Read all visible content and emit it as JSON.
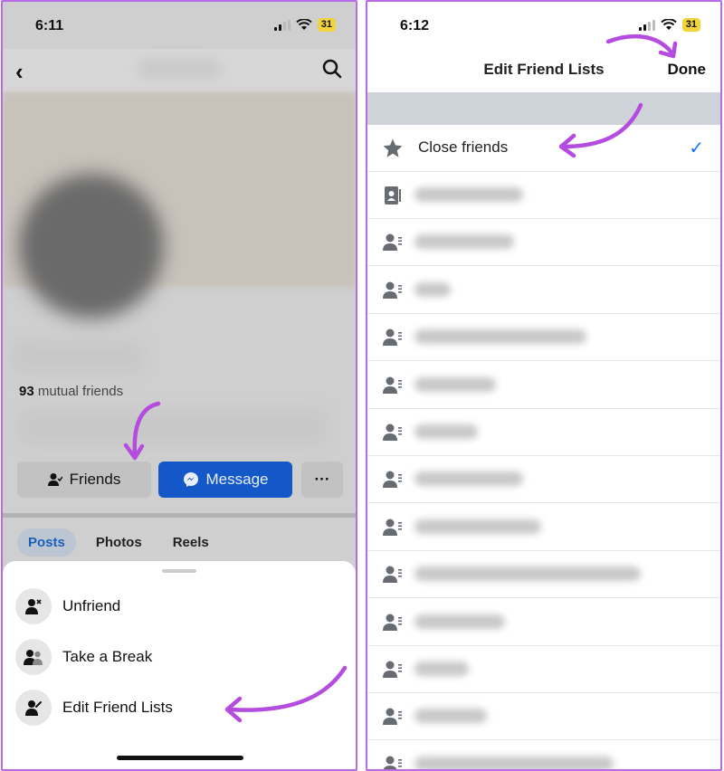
{
  "left_screen": {
    "status": {
      "time": "6:11",
      "battery": "31"
    },
    "mutual_count": "93",
    "mutual_text": "mutual friends",
    "buttons": {
      "friends": "Friends",
      "message": "Message",
      "more": "···"
    },
    "tabs": [
      "Posts",
      "Photos",
      "Reels"
    ],
    "active_tab": "Posts",
    "sheet_items": [
      {
        "label": "Unfriend",
        "icon": "unfriend-icon"
      },
      {
        "label": "Take a Break",
        "icon": "take-a-break-icon"
      },
      {
        "label": "Edit Friend Lists",
        "icon": "edit-friend-lists-icon"
      }
    ]
  },
  "right_screen": {
    "status": {
      "time": "6:12",
      "battery": "31"
    },
    "title": "Edit Friend Lists",
    "done_label": "Done",
    "first_row": {
      "label": "Close friends",
      "checked": true,
      "icon": "star-icon"
    },
    "other_rows_icon": "person-list-icon",
    "other_rows_count": 13
  },
  "colors": {
    "accent": "#1877f2",
    "annotation": "#b54ce0",
    "message_button": "#1457c8"
  }
}
